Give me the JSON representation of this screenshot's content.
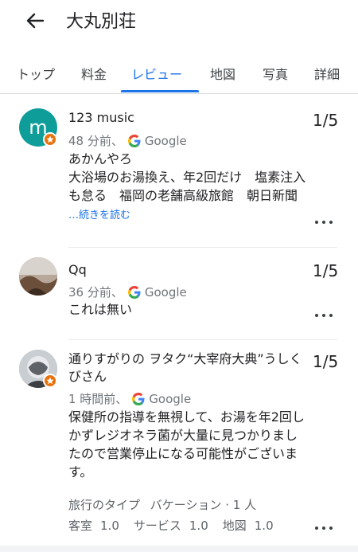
{
  "header": {
    "title": "大丸別荘"
  },
  "tabs": [
    "トップ",
    "料金",
    "レビュー",
    "地図",
    "写真",
    "詳細"
  ],
  "active_tab": "レビュー",
  "reviews": [
    {
      "author": "123 music",
      "avatar_letter": "m",
      "avatar_color": "#0f9d9a",
      "time": "48 分前、",
      "source": "Google",
      "score": "1/5",
      "text": "あかんやろ\n大浴場のお湯換え、年2回だけ　塩素注入も怠る　福岡の老舗高級旅館　朝日新聞",
      "read_more": "…続きを読む"
    },
    {
      "author": "Qq",
      "time": "36 分前、",
      "source": "Google",
      "score": "1/5",
      "text": "これは無い"
    },
    {
      "author": "通りすがりの ヲタク“大宰府大典”うしくびさん",
      "time": "1 時間前、",
      "source": "Google",
      "score": "1/5",
      "text": "保健所の指導を無視して、お湯を年2回しかずレジオネラ菌が大量に見つかりましたので営業停止になる可能性がございます。",
      "trip_type_label": "旅行のタイプ",
      "trip_type_value": "バケーション · 1 人",
      "ratings": [
        {
          "label": "客室",
          "value": "1.0"
        },
        {
          "label": "サービス",
          "value": "1.0"
        },
        {
          "label": "地図",
          "value": "1.0"
        }
      ]
    }
  ],
  "colors": {
    "accent": "#1a73e8",
    "badge": "#e8710a"
  },
  "icons": {
    "back": "arrow-left-icon",
    "more": "more-horiz-icon",
    "source": "google-g-icon",
    "badge": "local-guide-star-icon"
  }
}
